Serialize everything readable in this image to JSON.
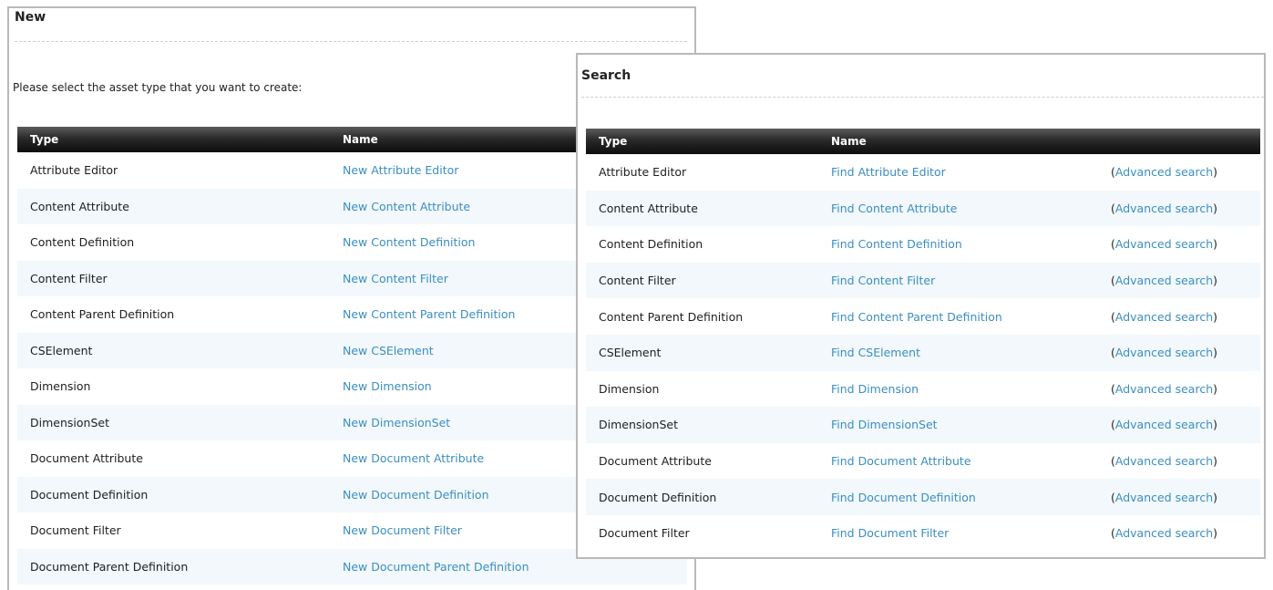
{
  "new_panel": {
    "title": "New",
    "prompt": "Please select the asset type that you want to create:",
    "headers": {
      "type": "Type",
      "name": "Name"
    },
    "rows": [
      {
        "type": "Attribute Editor",
        "name": "New Attribute Editor"
      },
      {
        "type": "Content Attribute",
        "name": "New Content Attribute"
      },
      {
        "type": "Content Definition",
        "name": "New Content Definition"
      },
      {
        "type": "Content Filter",
        "name": "New Content Filter"
      },
      {
        "type": "Content Parent Definition",
        "name": "New Content Parent Definition"
      },
      {
        "type": "CSElement",
        "name": "New CSElement"
      },
      {
        "type": "Dimension",
        "name": "New Dimension"
      },
      {
        "type": "DimensionSet",
        "name": "New DimensionSet"
      },
      {
        "type": "Document Attribute",
        "name": "New Document Attribute"
      },
      {
        "type": "Document Definition",
        "name": "New Document Definition"
      },
      {
        "type": "Document Filter",
        "name": "New Document Filter"
      },
      {
        "type": "Document Parent Definition",
        "name": "New Document Parent Definition"
      }
    ]
  },
  "search_panel": {
    "title": "Search",
    "headers": {
      "type": "Type",
      "name": "Name"
    },
    "advanced_open": "(",
    "advanced_label": "Advanced search",
    "advanced_close": ")",
    "rows": [
      {
        "type": "Attribute Editor",
        "name": "Find Attribute Editor"
      },
      {
        "type": "Content Attribute",
        "name": "Find Content Attribute"
      },
      {
        "type": "Content Definition",
        "name": "Find Content Definition"
      },
      {
        "type": "Content Filter",
        "name": "Find Content Filter"
      },
      {
        "type": "Content Parent Definition",
        "name": "Find Content Parent Definition"
      },
      {
        "type": "CSElement",
        "name": "Find CSElement"
      },
      {
        "type": "Dimension",
        "name": "Find Dimension"
      },
      {
        "type": "DimensionSet",
        "name": "Find DimensionSet"
      },
      {
        "type": "Document Attribute",
        "name": "Find Document Attribute"
      },
      {
        "type": "Document Definition",
        "name": "Find Document Definition"
      },
      {
        "type": "Document Filter",
        "name": "Find Document Filter"
      }
    ]
  },
  "colors": {
    "link": "#3b8ec2",
    "header_bg": "#1a1a1a",
    "row_alt": "#f2f8fb",
    "panel_border": "#b9b9b9"
  }
}
